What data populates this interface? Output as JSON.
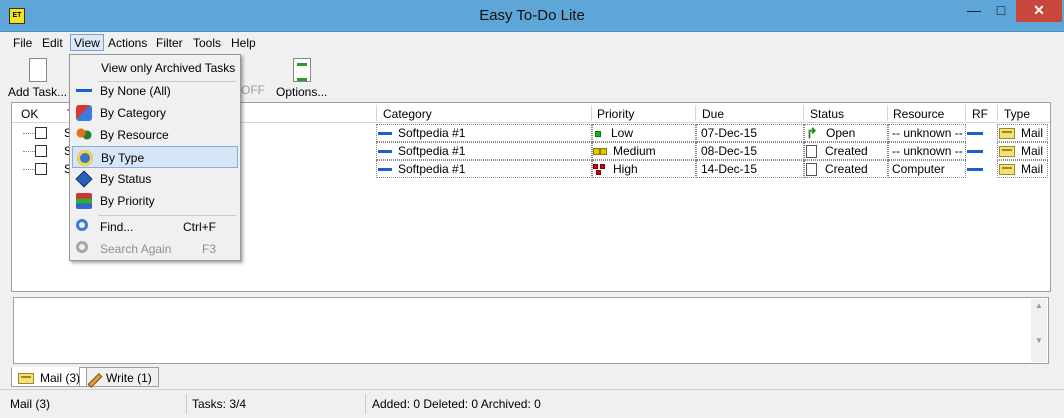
{
  "window": {
    "title": "Easy To-Do Lite",
    "app_icon": "ET",
    "minimize": "—",
    "maximize": "□",
    "close": "✕"
  },
  "menubar": {
    "items": [
      "File",
      "Edit",
      "View",
      "Actions",
      "Filter",
      "Tools",
      "Help"
    ],
    "active": "View"
  },
  "toolbar": {
    "add_task": "Add Task...",
    "off": "OFF",
    "options": "Options..."
  },
  "grid": {
    "headers": [
      "OK",
      "T",
      "Category",
      "Priority",
      "Due",
      "Status",
      "Resource",
      "RF",
      "Type"
    ],
    "rows": [
      {
        "title": "S",
        "category": "Softpedia #1",
        "priority": "Low",
        "priority_level": "low",
        "due": "07-Dec-15",
        "status": "Open",
        "resource": "-- unknown --",
        "type": "Mail"
      },
      {
        "title": "S",
        "category": "Softpedia #1",
        "priority": "Medium",
        "priority_level": "medium",
        "due": "08-Dec-15",
        "status": "Created",
        "resource": "-- unknown --",
        "type": "Mail"
      },
      {
        "title": "S",
        "category": "Softpedia #1",
        "priority": "High",
        "priority_level": "high",
        "due": "14-Dec-15",
        "status": "Created",
        "resource": "Computer",
        "type": "Mail"
      }
    ]
  },
  "view_menu": {
    "archived": "View only Archived Tasks",
    "by_none": "By None (All)",
    "by_category": "By Category",
    "by_resource": "By Resource",
    "by_type": "By Type",
    "by_status": "By Status",
    "by_priority": "By Priority",
    "find": "Find...",
    "find_shortcut": "Ctrl+F",
    "search_again": "Search Again",
    "search_again_shortcut": "F3",
    "highlighted": "By Type"
  },
  "tabs": {
    "mail": "Mail (3)",
    "write": "Write (1)"
  },
  "statusbar": {
    "left": "Mail (3)",
    "tasks": "Tasks: 3/4",
    "summary": "Added: 0 Deleted: 0 Archived: 0"
  },
  "colors": {
    "titlebar": "#5fa6d8",
    "close": "#c7473c",
    "highlight": "#d6e6f7",
    "accent_blue": "#1a5fcf"
  }
}
